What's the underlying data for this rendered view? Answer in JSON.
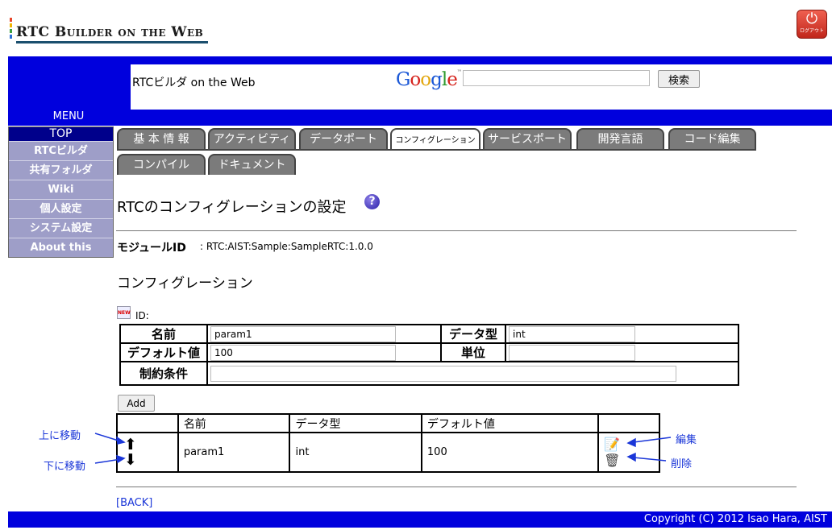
{
  "header": {
    "logo_text": "RTC Builder on the Web",
    "logout_label": "ログアウト",
    "logo_colors": [
      "#e8462a",
      "#f0b400",
      "#3ca142",
      "#2a6fd6"
    ]
  },
  "banner": {
    "site_name": "RTCビルダ on the Web",
    "google_logo": "Google",
    "search_button": "検索",
    "menu_label": "MENU"
  },
  "sidebar": {
    "top": "TOP",
    "items": [
      {
        "label": "RTCビルダ"
      },
      {
        "label": "共有フォルダ"
      },
      {
        "label": "Wiki"
      },
      {
        "label": "個人設定"
      },
      {
        "label": "システム設定"
      },
      {
        "label": "About this"
      }
    ]
  },
  "tabs": [
    {
      "label": "基 本 情 報"
    },
    {
      "label": "アクティビティ"
    },
    {
      "label": "データポート"
    },
    {
      "label": "コンフィグレーション",
      "active": true
    },
    {
      "label": "サービスポート"
    },
    {
      "label": "開発言語"
    },
    {
      "label": "コード編集"
    },
    {
      "label": "コンパイル"
    },
    {
      "label": "ドキュメント"
    }
  ],
  "main": {
    "title": "RTCのコンフィグレーションの設定",
    "help_icon": "?",
    "module_label": "モジュールID",
    "module_id": ": RTC:AIST:Sample:SampleRTC:1.0.0",
    "config_heading": "コンフィグレーション",
    "new_icon": "NEW",
    "id_label": "ID:"
  },
  "form": {
    "name_label": "名前",
    "name_value": "param1",
    "type_label": "データ型",
    "type_value": "int",
    "default_label": "デフォルト値",
    "default_value": "100",
    "unit_label": "単位",
    "unit_value": "",
    "constraint_label": "制約条件",
    "constraint_value": "",
    "add_button": "Add"
  },
  "list": {
    "headers": [
      "",
      "名前",
      "データ型",
      "デフォルト値",
      ""
    ],
    "rows": [
      {
        "name": "param1",
        "type": "int",
        "default": "100"
      }
    ]
  },
  "annotations": {
    "move_up": "上に移動",
    "move_down": "下に移動",
    "edit": "編集",
    "delete": "削除"
  },
  "footer": {
    "back_link": "[BACK]",
    "copyright": "Copyright (C) 2012 Isao Hara, AIST"
  }
}
